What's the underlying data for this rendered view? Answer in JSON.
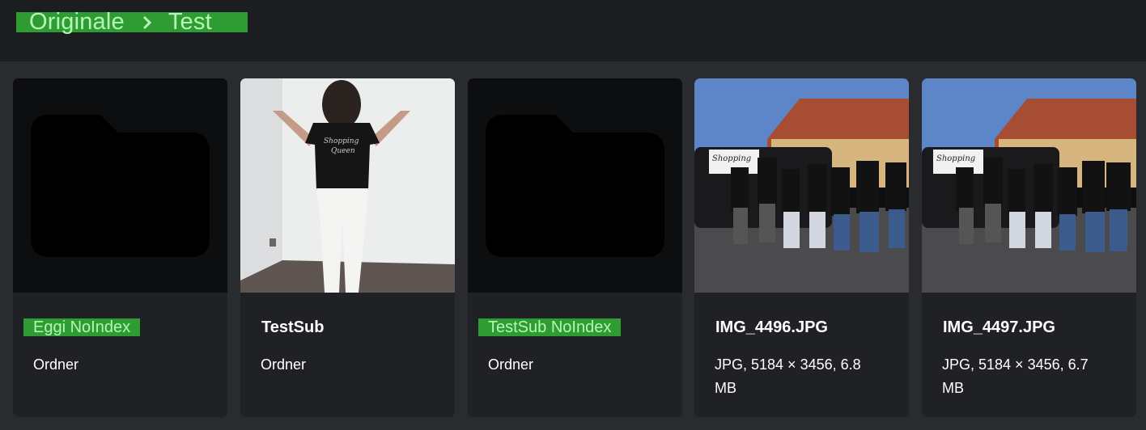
{
  "breadcrumb": {
    "items": [
      "Originale",
      "Test"
    ],
    "separator_icon": "chevron-right-icon"
  },
  "colors": {
    "highlight_bg": "#2f9c33",
    "highlight_text": "#b4f7b4",
    "card_bg": "#202124",
    "page_bg": "#2a2b2e",
    "topbar_bg": "#1c1d20"
  },
  "items": [
    {
      "title": "Eggi NoIndex",
      "meta": "Ordner",
      "kind": "folder",
      "thumb_icon": "folder-icon",
      "highlighted": true
    },
    {
      "title": "TestSub",
      "meta": "Ordner",
      "kind": "folder-preview",
      "thumb_icon": "photo-thumbnail",
      "highlighted": false
    },
    {
      "title": "TestSub NoIndex",
      "meta": "Ordner",
      "kind": "folder",
      "thumb_icon": "folder-icon",
      "highlighted": true
    },
    {
      "title": "IMG_4496.JPG",
      "meta": "JPG, 5184 × 3456, 6.8 MB",
      "kind": "image",
      "thumb_icon": "photo-thumbnail",
      "highlighted": false
    },
    {
      "title": "IMG_4497.JPG",
      "meta": "JPG, 5184 × 3456, 6.7 MB",
      "kind": "image",
      "thumb_icon": "photo-thumbnail",
      "highlighted": false
    }
  ]
}
